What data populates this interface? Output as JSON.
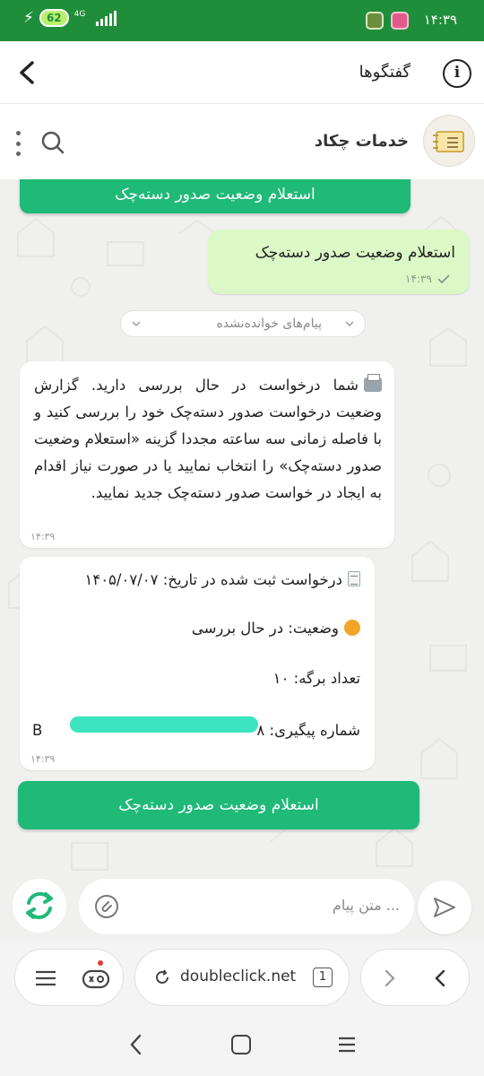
{
  "status_bar": {
    "time": "۱۴:۳۹",
    "battery": "62",
    "network": "4G"
  },
  "header": {
    "title": "گفتگوها",
    "info_icon_label": "i"
  },
  "chat": {
    "name": "خدمات چکاد"
  },
  "messages": {
    "top_button": "استعلام وضعیت صدور دسته‌چک",
    "outgoing": {
      "text": "استعلام وضعیت صدور دسته‌چک",
      "time": "۱۴:۳۹"
    },
    "unread_divider": "پیام‌های خوانده‌نشده",
    "incoming_1": {
      "text": "شما درخواست در حال بررسی دارید. گزارش وضعیت درخواست صدور دسته‌چک خود را بررسی کنید و با فاصله زمانی سه ساعته مجددا گزینه «استعلام وضعیت صدور دسته‌چک» را انتخاب نمایید یا در صورت نیاز اقدام به ایجاد در خواست صدور دسته‌چک جدید نمایید.",
      "time": "۱۴:۳۹"
    },
    "incoming_2": {
      "line1": "درخواست ثبت شده در تاریخ: ۱۴۰۵/۰۷/۰۷",
      "line2": "وضعیت: در حال بررسی",
      "line3": "تعداد برگه: ۱۰",
      "line4_label": "شماره پیگیری: ۸",
      "line4_value": "B",
      "time": "۱۴:۳۹"
    },
    "bottom_button": "استعلام وضعیت صدور دسته‌چک"
  },
  "composer": {
    "placeholder": "متن پیام ..."
  },
  "browser": {
    "url": "doubleclick.net",
    "tab_count": "1"
  },
  "icons": {
    "back": "chevron-left-icon",
    "info": "info-icon",
    "search": "search-icon",
    "menu": "kebab-menu-icon",
    "send": "send-icon",
    "attach": "attach-icon",
    "refresh": "refresh-icon"
  },
  "colors": {
    "status_bar": "#1f8e3a",
    "accent_green": "#1fb978",
    "outgoing_bubble": "#dcf8c6",
    "chat_background": "#f0f0ee",
    "redaction": "#3be3c1"
  }
}
